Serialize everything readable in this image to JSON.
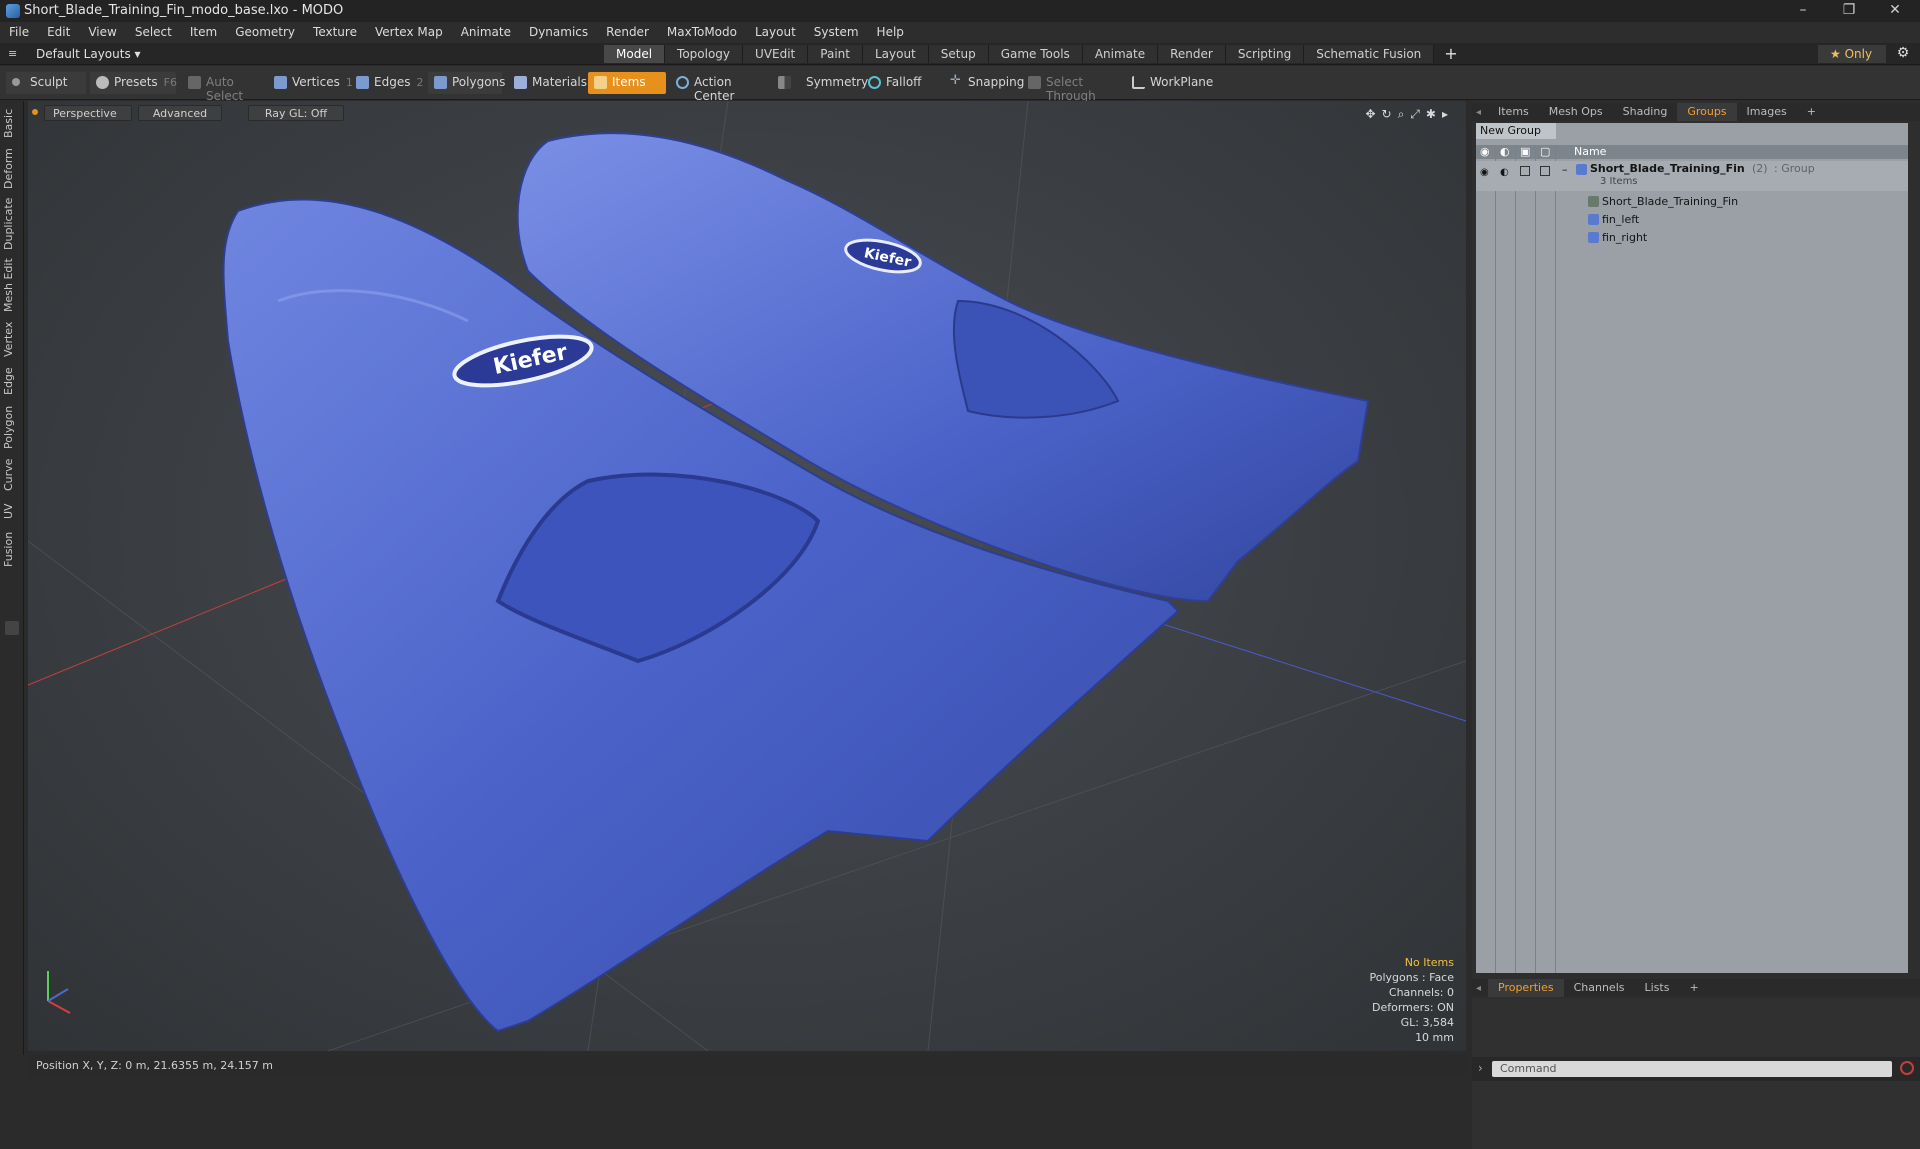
{
  "window": {
    "title": "Short_Blade_Training_Fin_modo_base.lxo - MODO",
    "minimize": "–",
    "maximize": "❐",
    "close": "✕"
  },
  "menu": [
    "File",
    "Edit",
    "View",
    "Select",
    "Item",
    "Geometry",
    "Texture",
    "Vertex Map",
    "Animate",
    "Dynamics",
    "Render",
    "MaxToModo",
    "Layout",
    "System",
    "Help"
  ],
  "layout": {
    "selector": "Default Layouts ▾",
    "tabs": [
      "Model",
      "Topology",
      "UVEdit",
      "Paint",
      "Layout",
      "Setup",
      "Game Tools",
      "Animate",
      "Render",
      "Scripting",
      "Schematic Fusion"
    ],
    "active_tab": "Model",
    "add": "+",
    "only": "★  Only",
    "gear": "⚙"
  },
  "toolbar": {
    "sculpt": "Sculpt",
    "presets": "Presets",
    "presets_key": "F6",
    "auto_select": "Auto Select",
    "vertices": "Vertices",
    "vertices_key": "1",
    "edges": "Edges",
    "edges_key": "2",
    "polygons": "Polygons",
    "materials": "Materials",
    "items": "Items",
    "action_center": "Action Center",
    "symmetry": "Symmetry",
    "falloff": "Falloff",
    "snapping": "Snapping",
    "select_through": "Select Through",
    "workplane": "WorkPlane"
  },
  "left_tabs": [
    "Basic",
    "Deform",
    "Duplicate",
    "Mesh Edit",
    "Vertex",
    "Edge",
    "Polygon",
    "Curve",
    "UV",
    "Fusion"
  ],
  "viewport": {
    "view": "Perspective",
    "shading": "Advanced",
    "raygl": "Ray GL: Off",
    "info": {
      "items": "No Items",
      "polygons": "Polygons : Face",
      "channels": "Channels: 0",
      "deformers": "Deformers: ON",
      "gl": "GL: 3,584",
      "scale": "10 mm"
    },
    "logo_text": "Kiefer"
  },
  "status": {
    "position": "Position X, Y, Z:   0 m, 21.6355 m, 24.157 m"
  },
  "right_panel": {
    "top_tabs": [
      "Items",
      "Mesh Ops",
      "Shading",
      "Groups",
      "Images",
      "+"
    ],
    "active_top_tab": "Groups",
    "new_group": "New Group",
    "column_name": "Name",
    "group": {
      "name": "Short_Blade_Training_Fin",
      "count": "(2)",
      "type": ": Group",
      "items_label": "3 Items"
    },
    "children": [
      "Short_Blade_Training_Fin",
      "fin_left",
      "fin_right"
    ],
    "bottom_tabs": [
      "Properties",
      "Channels",
      "Lists",
      "+"
    ],
    "active_bottom_tab": "Properties",
    "command_placeholder": "Command"
  },
  "colors": {
    "accent": "#e8901c",
    "fin_blue": "#4a64c8",
    "highlight": "#f0c040"
  }
}
